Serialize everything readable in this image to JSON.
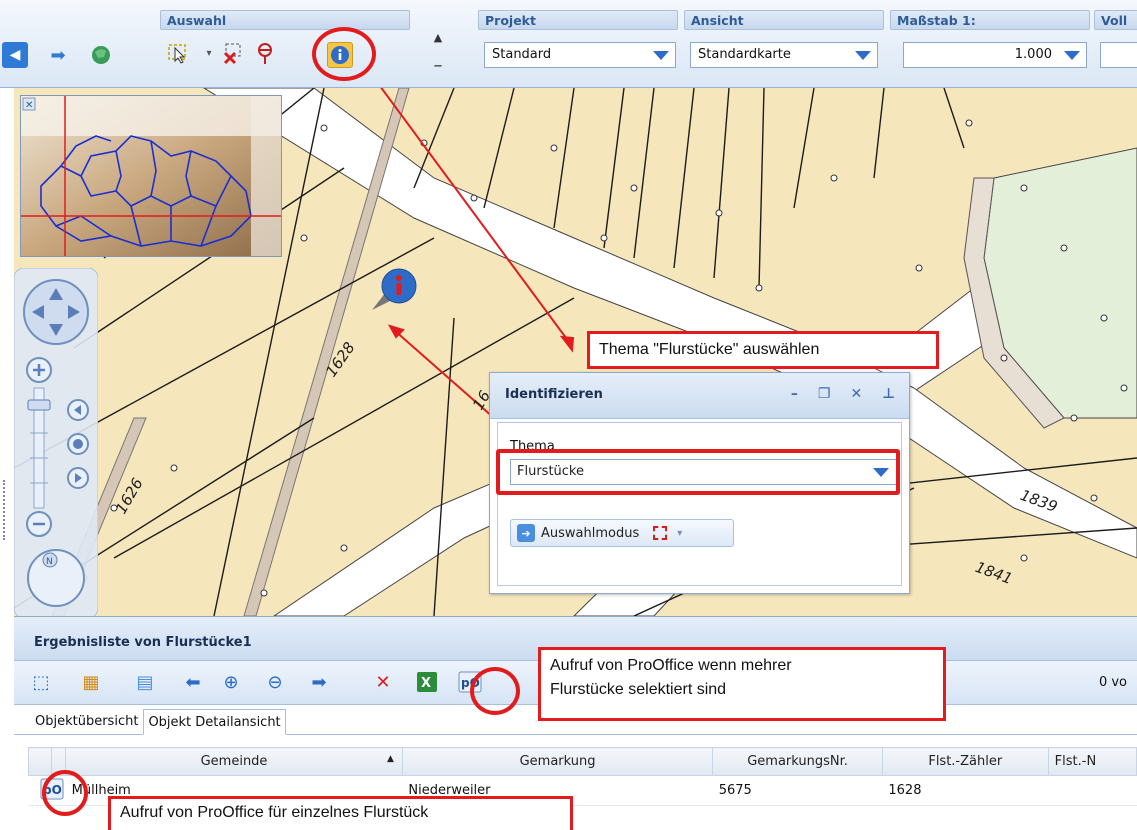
{
  "ribbon": {
    "groups": {
      "auswahl": "Auswahl",
      "projekt": "Projekt",
      "ansicht": "Ansicht",
      "massstab": "Maßstab 1:",
      "voll": "Voll"
    },
    "projekt_value": "Standard",
    "ansicht_value": "Standardkarte",
    "massstab_value": "1.000",
    "icons": [
      "arrow-left-icon",
      "arrow-right-icon",
      "globe-icon",
      "select-cursor-icon",
      "clear-selection-icon",
      "pin-icon",
      "info-icon",
      "scroll-up-icon",
      "scroll-down-icon"
    ]
  },
  "map": {
    "parcel_labels": [
      "1628",
      "1626",
      "16",
      "1839",
      "1841"
    ],
    "colors": {
      "parcel_fill": "#f6e6bc",
      "road": "#ffffff",
      "forest": "#e3efd8",
      "boundary": "#1c1c1c"
    }
  },
  "identify": {
    "title": "Identifizieren",
    "thema_label": "Thema",
    "thema_value": "Flurstücke",
    "auswahlmodus_label": "Auswahlmodus"
  },
  "callouts": {
    "thema": "Thema \"Flurstücke\" auswählen",
    "prooffice_multi_line1": "Aufruf von ProOffice wenn mehrer",
    "prooffice_multi_line2": "Flurstücke selektiert sind",
    "prooffice_single": "Aufruf von ProOffice für einzelnes Flurstück"
  },
  "results": {
    "title": "Ergebnisliste von Flurstücke1",
    "count_text": "0 vo",
    "tabs": [
      "Objektübersicht",
      "Objekt Detailansicht"
    ],
    "columns": [
      "Gemeinde",
      "Gemarkung",
      "GemarkungsNr.",
      "Flst.-Zähler",
      "Flst.-N"
    ],
    "rows": [
      {
        "gemeinde": "Müllheim",
        "gemarkung": "Niederweiler",
        "gemarkungsnr": "5675",
        "zaehler": "1628",
        "nenner": ""
      }
    ]
  }
}
